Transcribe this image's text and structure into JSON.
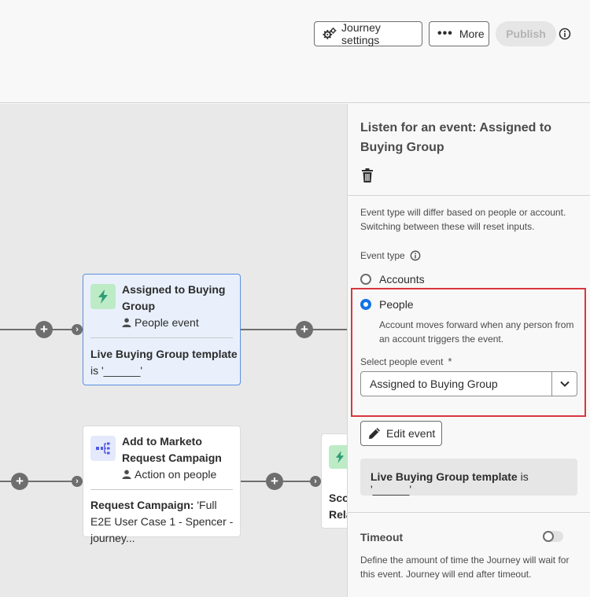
{
  "header": {
    "journey_settings_label": "Journey settings",
    "more_label": "More",
    "publish_label": "Publish"
  },
  "canvas": {
    "node_assigned": {
      "title": "Assigned to Buying Group",
      "subtitle": "People event",
      "body_bold": "Live Buying Group template",
      "body_rest": " is '______'"
    },
    "node_marketo": {
      "title": "Add to Marketo Request Campaign",
      "subtitle": "Action on people",
      "body_bold": "Request Campaign:",
      "body_rest": " 'Full E2E User Case 1 - Spencer -journey..."
    },
    "node_partial": {
      "line1": "Scor",
      "line2": "Rela"
    }
  },
  "panel": {
    "title": "Listen for an event: Assigned to Buying Group",
    "event_type_desc": "Event type will differ based on people or account. Switching between these will reset inputs.",
    "event_type_label": "Event type",
    "options": [
      {
        "label": "Accounts",
        "selected": false
      },
      {
        "label": "People",
        "selected": true
      }
    ],
    "people_desc": "Account moves forward when any person from an account triggers the event.",
    "select_label": "Select people event",
    "required_mark": "*",
    "select_value": "Assigned to Buying Group",
    "edit_event_label": "Edit event",
    "condition_bold": "Live Buying Group template",
    "condition_rest": " is '______'",
    "timeout_title": "Timeout",
    "timeout_enabled": false,
    "timeout_desc": "Define the amount of time the Journey will wait for this event. Journey will end after timeout."
  },
  "colors": {
    "accent": "#1473e6",
    "highlight": "#d7373f",
    "event_icon_bg": "#bdebc6",
    "event_icon": "#2d9d78",
    "action_icon": "#5258e4"
  }
}
